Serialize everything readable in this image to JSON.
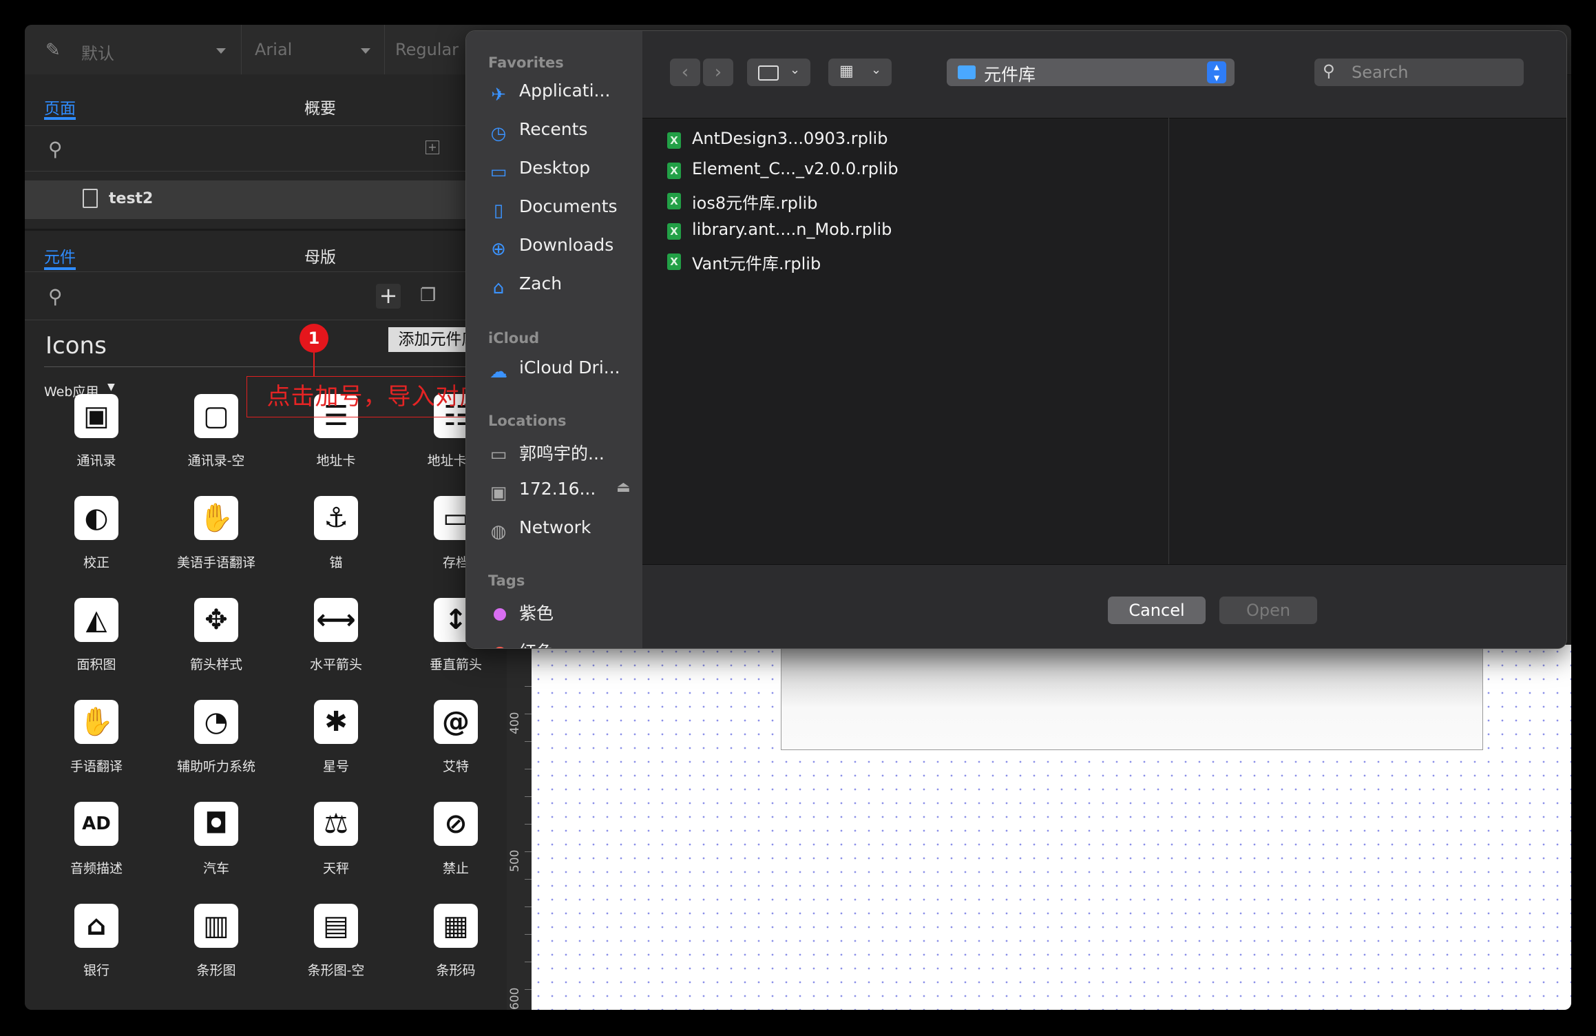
{
  "toolbar": {
    "style": "默认",
    "font": "Arial",
    "weight": "Regular"
  },
  "pages_panel": {
    "tab_pages": "页面",
    "tab_outline": "概要",
    "page_item": "test2"
  },
  "widgets_panel": {
    "tab_widgets": "元件",
    "tab_masters": "母版",
    "library_title": "Icons",
    "category": "Web应用"
  },
  "icons": [
    {
      "label": "通讯录",
      "glyph": "▣"
    },
    {
      "label": "通讯录-空",
      "glyph": "▢"
    },
    {
      "label": "地址卡",
      "glyph": "☰"
    },
    {
      "label": "地址卡-空",
      "glyph": "☷"
    },
    {
      "label": "校正",
      "glyph": "◐"
    },
    {
      "label": "美语手语翻译",
      "glyph": "✋"
    },
    {
      "label": "锚",
      "glyph": "⚓"
    },
    {
      "label": "存档",
      "glyph": "▭"
    },
    {
      "label": "面积图",
      "glyph": "◭"
    },
    {
      "label": "箭头样式",
      "glyph": "✥"
    },
    {
      "label": "水平箭头",
      "glyph": "⟷"
    },
    {
      "label": "垂直箭头",
      "glyph": "↕"
    },
    {
      "label": "手语翻译",
      "glyph": "✋"
    },
    {
      "label": "辅助听力系统",
      "glyph": "◔"
    },
    {
      "label": "星号",
      "glyph": "✱"
    },
    {
      "label": "艾特",
      "glyph": "@"
    },
    {
      "label": "音频描述",
      "glyph": "AD"
    },
    {
      "label": "汽车",
      "glyph": "◘"
    },
    {
      "label": "天秤",
      "glyph": "⚖"
    },
    {
      "label": "禁止",
      "glyph": "⊘"
    },
    {
      "label": "银行",
      "glyph": "⌂"
    },
    {
      "label": "条形图",
      "glyph": "▥"
    },
    {
      "label": "条形图-空",
      "glyph": "▤"
    },
    {
      "label": "条形码",
      "glyph": "▦"
    }
  ],
  "ruler": {
    "labels": [
      "400",
      "500",
      "600"
    ]
  },
  "dialog": {
    "favorites_header": "Favorites",
    "favorites": [
      {
        "label": "Applicati...",
        "icon": "applications-icon"
      },
      {
        "label": "Recents",
        "icon": "clock-icon"
      },
      {
        "label": "Desktop",
        "icon": "desktop-icon"
      },
      {
        "label": "Documents",
        "icon": "document-icon"
      },
      {
        "label": "Downloads",
        "icon": "download-icon"
      },
      {
        "label": "Zach",
        "icon": "home-icon"
      }
    ],
    "icloud_header": "iCloud",
    "icloud": [
      {
        "label": "iCloud Dri...",
        "icon": "cloud-icon"
      }
    ],
    "locations_header": "Locations",
    "locations": [
      {
        "label": "郭鸣宇的...",
        "icon": "laptop-icon"
      },
      {
        "label": "172.16...",
        "icon": "display-icon"
      },
      {
        "label": "Network",
        "icon": "globe-icon"
      }
    ],
    "tags_header": "Tags",
    "tags": [
      {
        "label": "紫色",
        "color": "#d86ef2"
      },
      {
        "label": "红色",
        "color": "#ff5b4f"
      }
    ],
    "current_folder": "元件库",
    "search_placeholder": "Search",
    "files": [
      "AntDesign3...0903.rplib",
      "Element_C..._v2.0.0.rplib",
      "ios8元件库.rplib",
      "library.ant....n_Mob.rplib",
      "Vant元件库.rplib"
    ],
    "cancel_label": "Cancel",
    "open_label": "Open"
  },
  "annotation": {
    "number": "1",
    "text": "点击加号，导入对应的元件库即可",
    "tooltip": "添加元件库"
  }
}
